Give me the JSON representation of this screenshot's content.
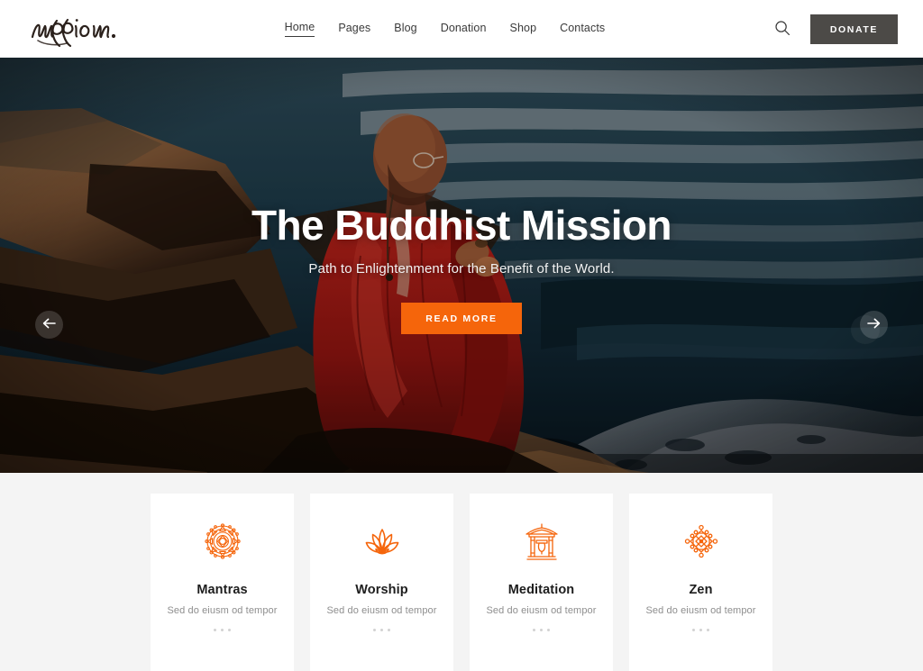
{
  "colors": {
    "accent_orange": "#F5650B",
    "donate_button_bg": "#4C4A47",
    "section_bg": "#F4F4F4",
    "card_bg": "#FFFFFF",
    "text_dark": "#1D1D1D",
    "text_muted": "#8E8E8E"
  },
  "header": {
    "logo_text": "mission.",
    "logo_icon": "script-wordmark-logo",
    "nav": [
      {
        "label": "Home",
        "active": true
      },
      {
        "label": "Pages",
        "active": false
      },
      {
        "label": "Blog",
        "active": false
      },
      {
        "label": "Donation",
        "active": false
      },
      {
        "label": "Shop",
        "active": false
      },
      {
        "label": "Contacts",
        "active": false
      }
    ],
    "search_icon": "search-icon",
    "donate_label": "DONATE"
  },
  "hero": {
    "title": "The Buddhist Mission",
    "subtitle": "Path to Enlightenment for the Benefit of the World.",
    "cta_label": "READ MORE",
    "prev_icon": "arrow-left-icon",
    "next_icon": "arrow-right-icon",
    "image_alt": "Buddhist monk in red robes seated on coastal rocks beside dark water"
  },
  "features": {
    "cards": [
      {
        "title": "Mantras",
        "subtitle": "Sed do eiusm od tempor",
        "icon": "mandala-icon"
      },
      {
        "title": "Worship",
        "subtitle": "Sed do eiusm od tempor",
        "icon": "lotus-icon"
      },
      {
        "title": "Meditation",
        "subtitle": "Sed do eiusm od tempor",
        "icon": "temple-gate-icon"
      },
      {
        "title": "Zen",
        "subtitle": "Sed do eiusm od tempor",
        "icon": "endless-knot-icon"
      }
    ]
  }
}
